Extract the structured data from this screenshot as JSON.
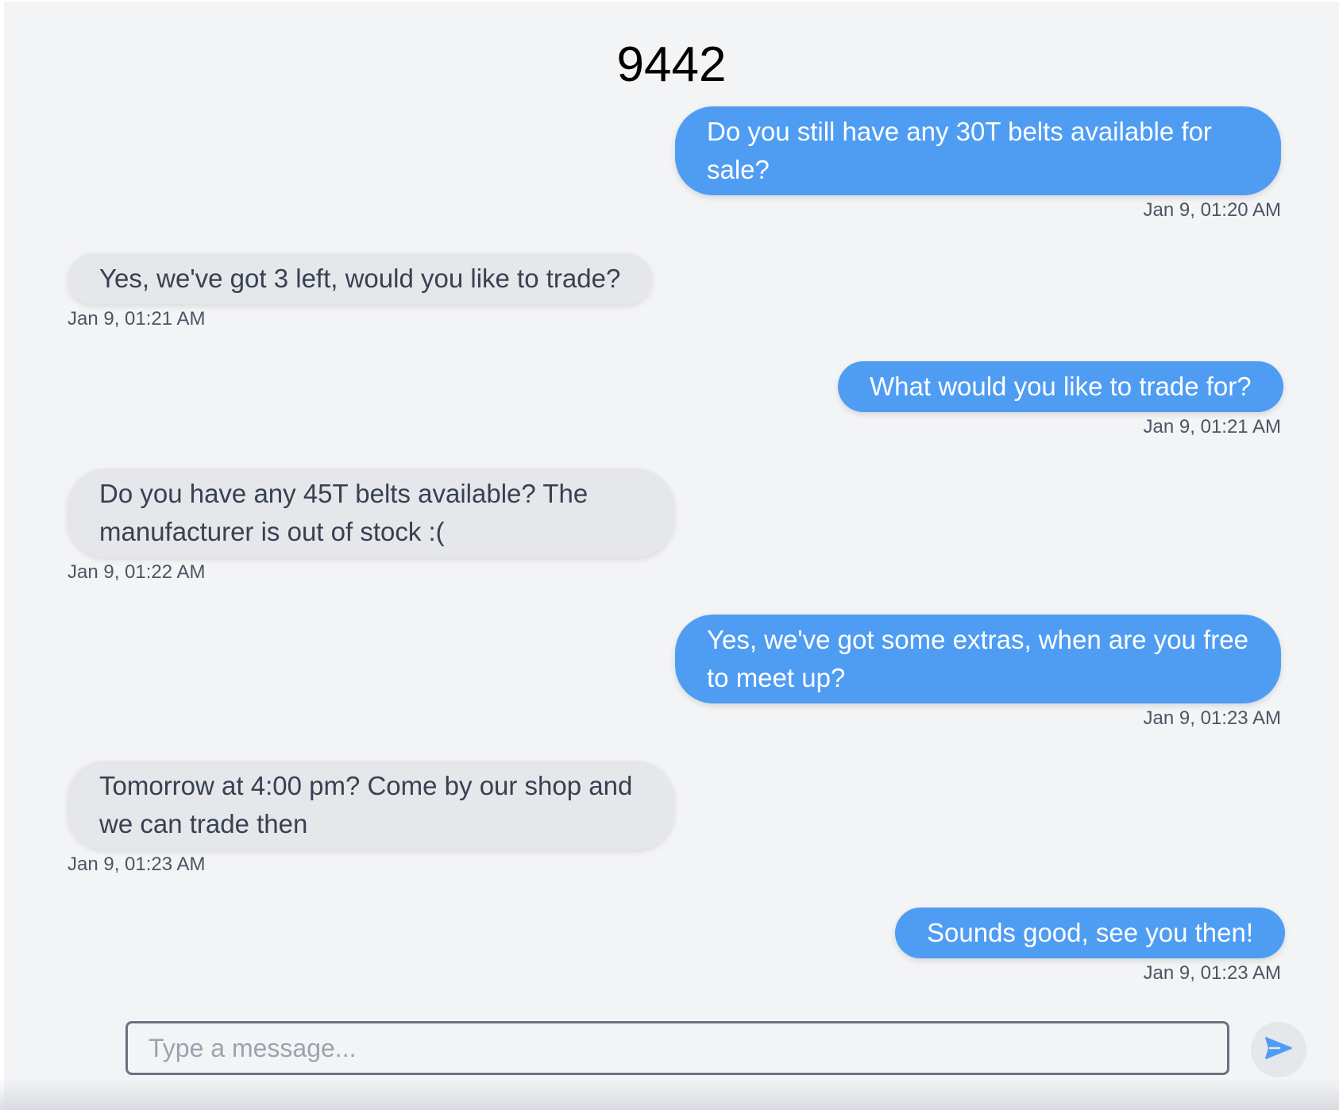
{
  "chat": {
    "title": "9442",
    "messages": [
      {
        "direction": "out",
        "text": "Do you still have any 30T belts available for sale?",
        "time": "Jan 9, 01:20 AM"
      },
      {
        "direction": "in",
        "text": "Yes, we've got 3 left, would you like to trade?",
        "time": "Jan 9, 01:21 AM"
      },
      {
        "direction": "out",
        "text": "What would you like to trade for?",
        "time": "Jan 9, 01:21 AM"
      },
      {
        "direction": "in",
        "text": "Do you have any 45T belts available? The manufacturer is out of stock :(",
        "time": "Jan 9, 01:22 AM"
      },
      {
        "direction": "out",
        "text": "Yes, we've got some extras, when are you free to meet up?",
        "time": "Jan 9, 01:23 AM"
      },
      {
        "direction": "in",
        "text": "Tomorrow at 4:00 pm? Come by our shop and we can trade then",
        "time": "Jan 9, 01:23 AM"
      },
      {
        "direction": "out",
        "text": "Sounds good, see you then!",
        "time": "Jan 9, 01:23 AM"
      }
    ]
  },
  "composer": {
    "placeholder": "Type a message...",
    "value": ""
  },
  "icons": {
    "send": "send-icon"
  },
  "colors": {
    "outgoing_bubble": "#4f9df3",
    "incoming_bubble": "#e5e7eb",
    "background": "#f3f4f6",
    "send_icon": "#4f9df3"
  }
}
